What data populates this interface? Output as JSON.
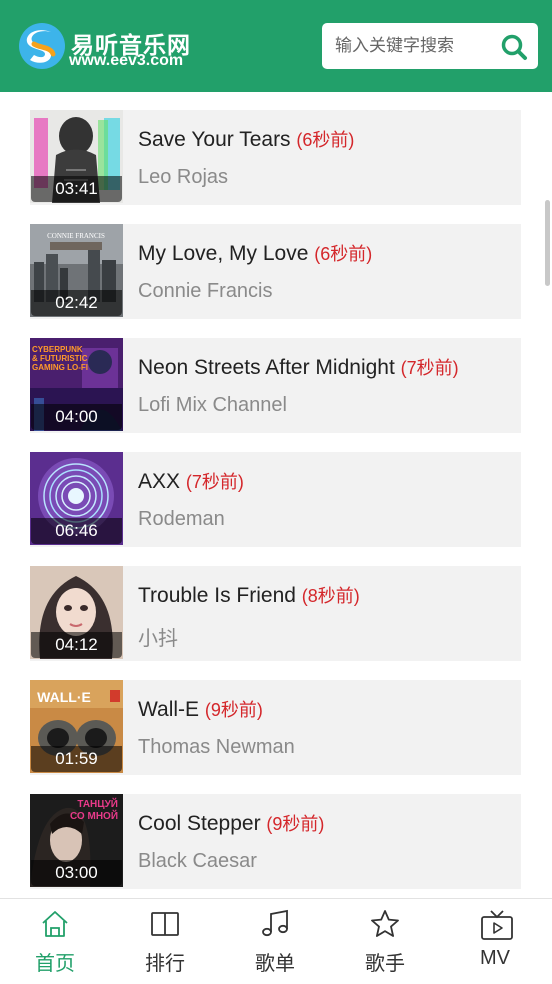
{
  "header": {
    "site_name": "易听音乐网",
    "domain": "www.eev3.com",
    "search_placeholder": "输入关键字搜索",
    "search_value": ""
  },
  "songs": [
    {
      "title": "Save Your Tears",
      "time_ago": "(6秒前)",
      "artist": "Leo Rojas",
      "duration": "03:41"
    },
    {
      "title": "My Love, My Love",
      "time_ago": "(6秒前)",
      "artist": "Connie Francis",
      "duration": "02:42"
    },
    {
      "title": "Neon Streets After Midnight",
      "time_ago": "(7秒前)",
      "artist": "Lofi Mix Channel",
      "duration": "04:00"
    },
    {
      "title": "AXX",
      "time_ago": "(7秒前)",
      "artist": "Rodeman",
      "duration": "06:46"
    },
    {
      "title": "Trouble Is Friend",
      "time_ago": "(8秒前)",
      "artist": "小抖",
      "duration": "04:12"
    },
    {
      "title": "Wall-E",
      "time_ago": "(9秒前)",
      "artist": "Thomas Newman",
      "duration": "01:59"
    },
    {
      "title": "Cool Stepper",
      "time_ago": "(9秒前)",
      "artist": "Black Caesar",
      "duration": "03:00"
    }
  ],
  "thumb_text": {
    "connie": "CONNIE FRANCIS",
    "cyber1": "CYBERPUNK",
    "cyber2": "& FUTURISTIC",
    "cyber3": "GAMING LO-FI",
    "walle": "WALL·E",
    "tanc1": "ТАНЦУЙ",
    "tanc2": "СО МНОЙ"
  },
  "tabs": [
    {
      "label": "首页",
      "icon": "home-icon",
      "active": true
    },
    {
      "label": "排行",
      "icon": "book-icon",
      "active": false
    },
    {
      "label": "歌单",
      "icon": "music-note-icon",
      "active": false
    },
    {
      "label": "歌手",
      "icon": "star-icon",
      "active": false
    },
    {
      "label": "MV",
      "icon": "tv-play-icon",
      "active": false
    }
  ],
  "colors": {
    "brand": "#22a06a",
    "time_ago": "#d4272b",
    "row_bg": "#f2f2f2"
  }
}
